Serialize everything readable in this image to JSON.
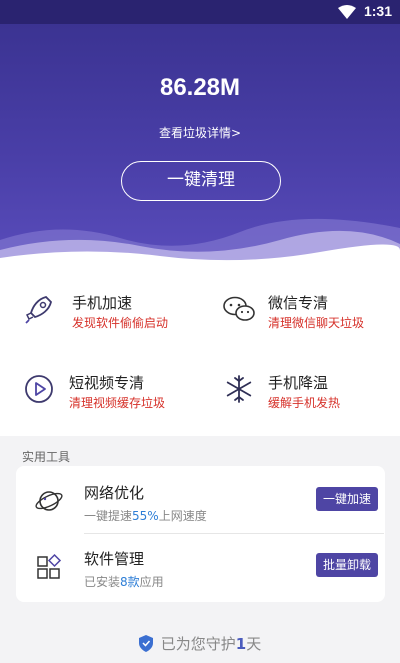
{
  "status_bar": {
    "time": "1:31",
    "wifi_icon": "wifi-icon"
  },
  "hero": {
    "junk_size": "86.28M",
    "junk_detail_link": "查看垃圾详情>",
    "clean_button": "一键清理"
  },
  "features": [
    {
      "icon": "rocket-icon",
      "title": "手机加速",
      "subtitle": "发现软件偷偷启动"
    },
    {
      "icon": "wechat-icon",
      "title": "微信专清",
      "subtitle": "清理微信聊天垃圾"
    },
    {
      "icon": "play-icon",
      "title": "短视频专清",
      "subtitle": "清理视频缓存垃圾"
    },
    {
      "icon": "snowflake-icon",
      "title": "手机降温",
      "subtitle": "缓解手机发热"
    }
  ],
  "tools": {
    "section_label": "实用工具",
    "items": [
      {
        "icon": "network-globe-icon",
        "name": "网络优化",
        "desc_prefix": "一键提速",
        "desc_highlight": "55%",
        "desc_suffix": "上网速度",
        "button": "一键加速"
      },
      {
        "icon": "apps-grid-icon",
        "name": "软件管理",
        "desc_prefix": "已安装",
        "desc_highlight": "8款",
        "desc_suffix": "应用",
        "button": "批量卸载"
      }
    ]
  },
  "footer": {
    "prefix": "已为您守护",
    "days": "1",
    "suffix": "天",
    "icon": "shield-icon"
  },
  "colors": {
    "hero_bg": "#4a3fa8",
    "accent_button": "#4e45a4",
    "warning_text": "#d6312a",
    "highlight": "#2e7ed6"
  }
}
